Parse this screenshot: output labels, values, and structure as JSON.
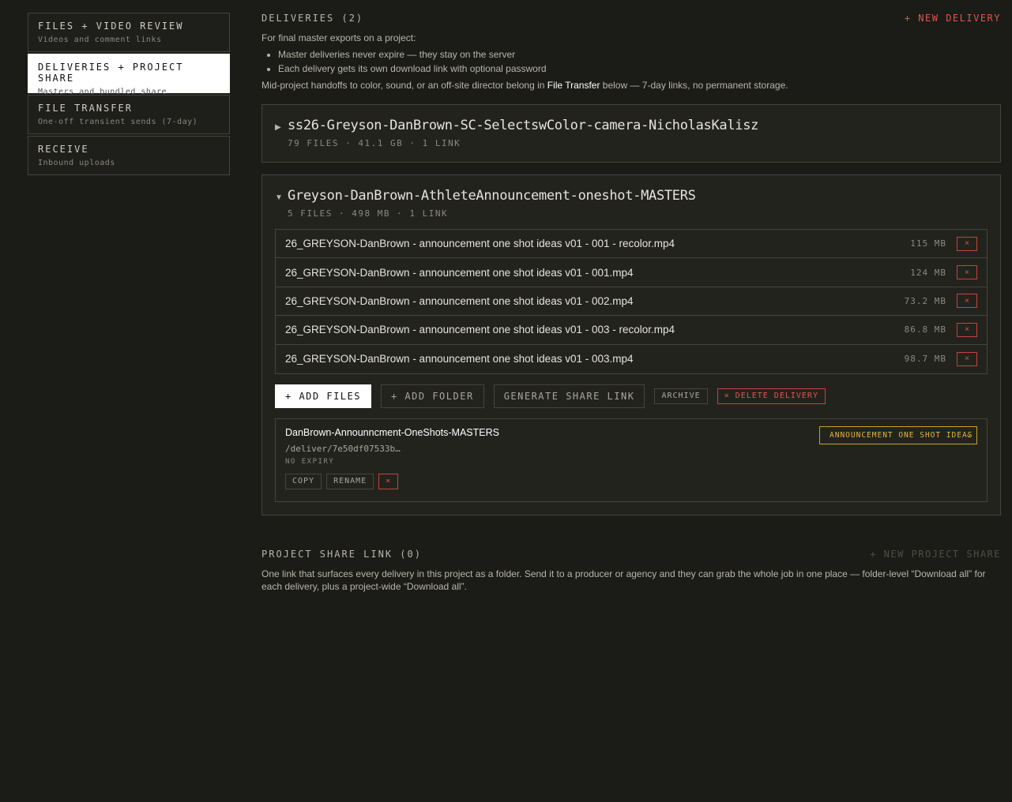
{
  "sidebar": {
    "items": [
      {
        "title": "FILES + VIDEO REVIEW",
        "sub": "Videos and comment links"
      },
      {
        "title": "DELIVERIES + PROJECT SHARE",
        "sub": "Masters and bundled share"
      },
      {
        "title": "FILE TRANSFER",
        "sub": "One-off transient sends (7-day)"
      },
      {
        "title": "RECEIVE",
        "sub": "Inbound uploads"
      }
    ]
  },
  "deliveries": {
    "title": "DELIVERIES (2)",
    "new_label": "+ NEW DELIVERY",
    "intro_lead": "For final master exports on a project:",
    "bullets": [
      "Master deliveries never expire — they stay on the server",
      "Each delivery gets its own download link with optional password"
    ],
    "handoff_pre": "Mid-project handoffs to color, sound, or an off-site director belong in ",
    "handoff_link": "File Transfer",
    "handoff_post": " below — 7-day links, no permanent storage.",
    "collapsed": {
      "arrow": "▶",
      "name": "ss26-Greyson-DanBrown-SC-SelectswColor-camera-NicholasKalisz",
      "meta": "79 FILES · 41.1 GB · 1 LINK"
    },
    "expanded": {
      "arrow": "▼",
      "name": "Greyson-DanBrown-AthleteAnnouncement-oneshot-MASTERS",
      "meta": "5 FILES · 498 MB · 1 LINK",
      "files": [
        {
          "name": "26_GREYSON-DanBrown - announcement one shot ideas v01 - 001 - recolor.mp4",
          "size": "115 MB"
        },
        {
          "name": "26_GREYSON-DanBrown - announcement one shot ideas v01 - 001.mp4",
          "size": "124 MB"
        },
        {
          "name": "26_GREYSON-DanBrown - announcement one shot ideas v01 - 002.mp4",
          "size": "73.2 MB"
        },
        {
          "name": "26_GREYSON-DanBrown - announcement one shot ideas v01 - 003 - recolor.mp4",
          "size": "86.8 MB"
        },
        {
          "name": "26_GREYSON-DanBrown - announcement one shot ideas v01 - 003.mp4",
          "size": "98.7 MB"
        }
      ],
      "remove_glyph": "×",
      "actions": {
        "add_files": "+ ADD FILES",
        "add_folder": "+ ADD FOLDER",
        "generate": "GENERATE SHARE LINK",
        "archive": "ARCHIVE",
        "delete": "× DELETE DELIVERY"
      },
      "share": {
        "name": "DanBrown-Announncment-OneShots-MASTERS",
        "path": "/deliver/7e50df07533b…",
        "expiry": "NO EXPIRY",
        "copy": "COPY",
        "rename": "RENAME",
        "remove": "×",
        "select_value": "ANNOUNCEMENT ONE SHOT IDEAS"
      }
    }
  },
  "project_share": {
    "title": "PROJECT SHARE LINK (0)",
    "new_label": "+ NEW PROJECT SHARE",
    "desc": "One link that surfaces every delivery in this project as a folder. Send it to a producer or agency and they can grab the whole job in one place — folder-level “Download all” for each delivery, plus a project-wide “Download all”."
  },
  "colors": {
    "background": "#1b1b17",
    "danger": "#e0554e",
    "accent_select": "#c9a227",
    "active_nav": "#ffffff"
  },
  "icons": {
    "expand": "triangle-right-icon",
    "collapse": "triangle-down-icon",
    "remove": "close-icon",
    "select": "chevron-down-icon"
  }
}
